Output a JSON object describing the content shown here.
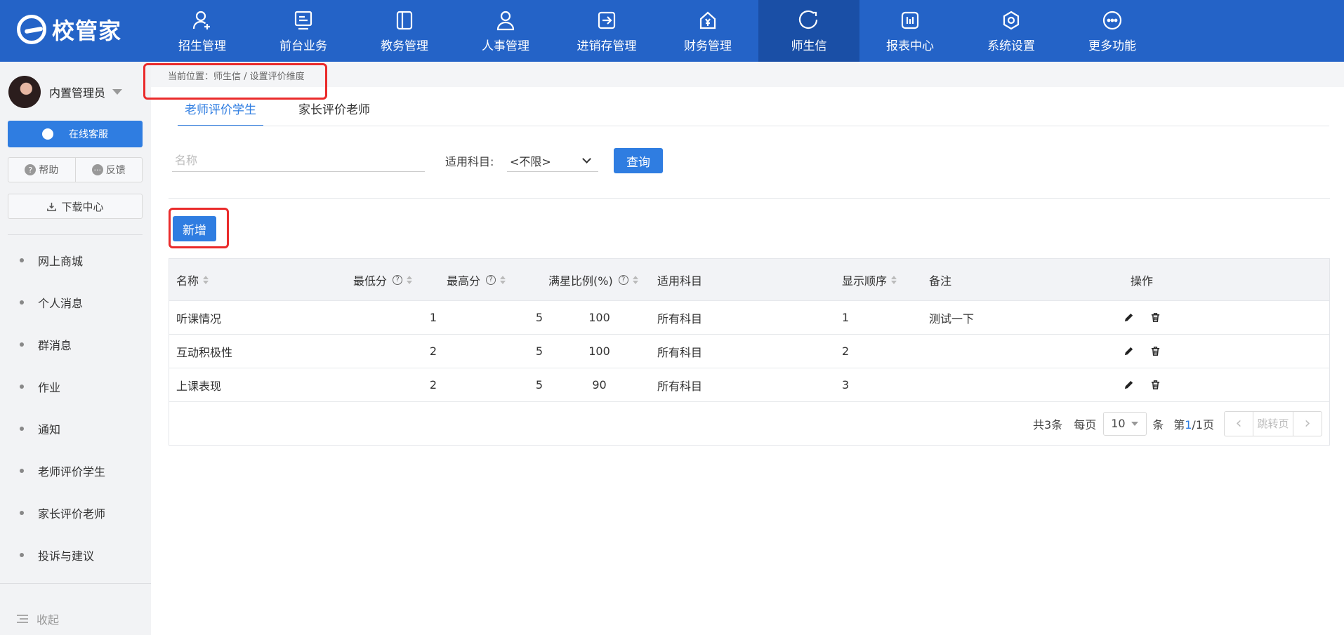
{
  "app": {
    "logo_text": "校管家"
  },
  "nav": [
    {
      "label": "招生管理",
      "icon": "user-plus-icon"
    },
    {
      "label": "前台业务",
      "icon": "monitor-icon"
    },
    {
      "label": "教务管理",
      "icon": "book-icon"
    },
    {
      "label": "人事管理",
      "icon": "person-icon"
    },
    {
      "label": "进销存管理",
      "icon": "arrow-in-box-icon"
    },
    {
      "label": "财务管理",
      "icon": "yuan-house-icon"
    },
    {
      "label": "师生信",
      "icon": "chat-bubble-icon"
    },
    {
      "label": "报表中心",
      "icon": "bar-chart-icon"
    },
    {
      "label": "系统设置",
      "icon": "settings-hex-icon"
    },
    {
      "label": "更多功能",
      "icon": "more-dots-icon"
    }
  ],
  "nav_active": "师生信",
  "sidebar": {
    "user_name": "内置管理员",
    "service_label": "在线客服",
    "help_label": "帮助",
    "feedback_label": "反馈",
    "download_label": "下载中心",
    "menu": [
      "网上商城",
      "个人消息",
      "群消息",
      "作业",
      "通知",
      "老师评价学生",
      "家长评价老师",
      "投诉与建议"
    ],
    "collapse_label": "收起"
  },
  "breadcrumb": "当前位置：师生信 / 设置评价维度",
  "tabs": [
    {
      "label": "老师评价学生",
      "active": true
    },
    {
      "label": "家长评价老师",
      "active": false
    }
  ],
  "filters": {
    "name_placeholder": "名称",
    "subject_label": "适用科目:",
    "subject_value": "<不限>",
    "query_label": "查询"
  },
  "add_label": "新增",
  "table": {
    "headers": [
      "名称",
      "最低分",
      "最高分",
      "满星比例(%)",
      "适用科目",
      "显示顺序",
      "备注",
      "操作"
    ],
    "rows": [
      {
        "name": "听课情况",
        "min": "1",
        "max": "5",
        "ratio": "100",
        "subject": "所有科目",
        "order": "1",
        "note": "测试一下"
      },
      {
        "name": "互动积极性",
        "min": "2",
        "max": "5",
        "ratio": "100",
        "subject": "所有科目",
        "order": "2",
        "note": ""
      },
      {
        "name": "上课表现",
        "min": "2",
        "max": "5",
        "ratio": "90",
        "subject": "所有科目",
        "order": "3",
        "note": ""
      }
    ]
  },
  "pagination": {
    "total_text": "共3条",
    "per_page_label": "每页",
    "per_page_value": "10",
    "unit_label": "条",
    "page_prefix": "第",
    "page_current": "1",
    "page_suffix": "/1页",
    "jump_label": "跳转页",
    "prev_icon": "chevron-left-icon",
    "next_icon": "chevron-right-icon"
  },
  "colors": {
    "primary": "#2f7de1",
    "navbar": "#2463c7",
    "highlight": "#ea2b2b"
  }
}
